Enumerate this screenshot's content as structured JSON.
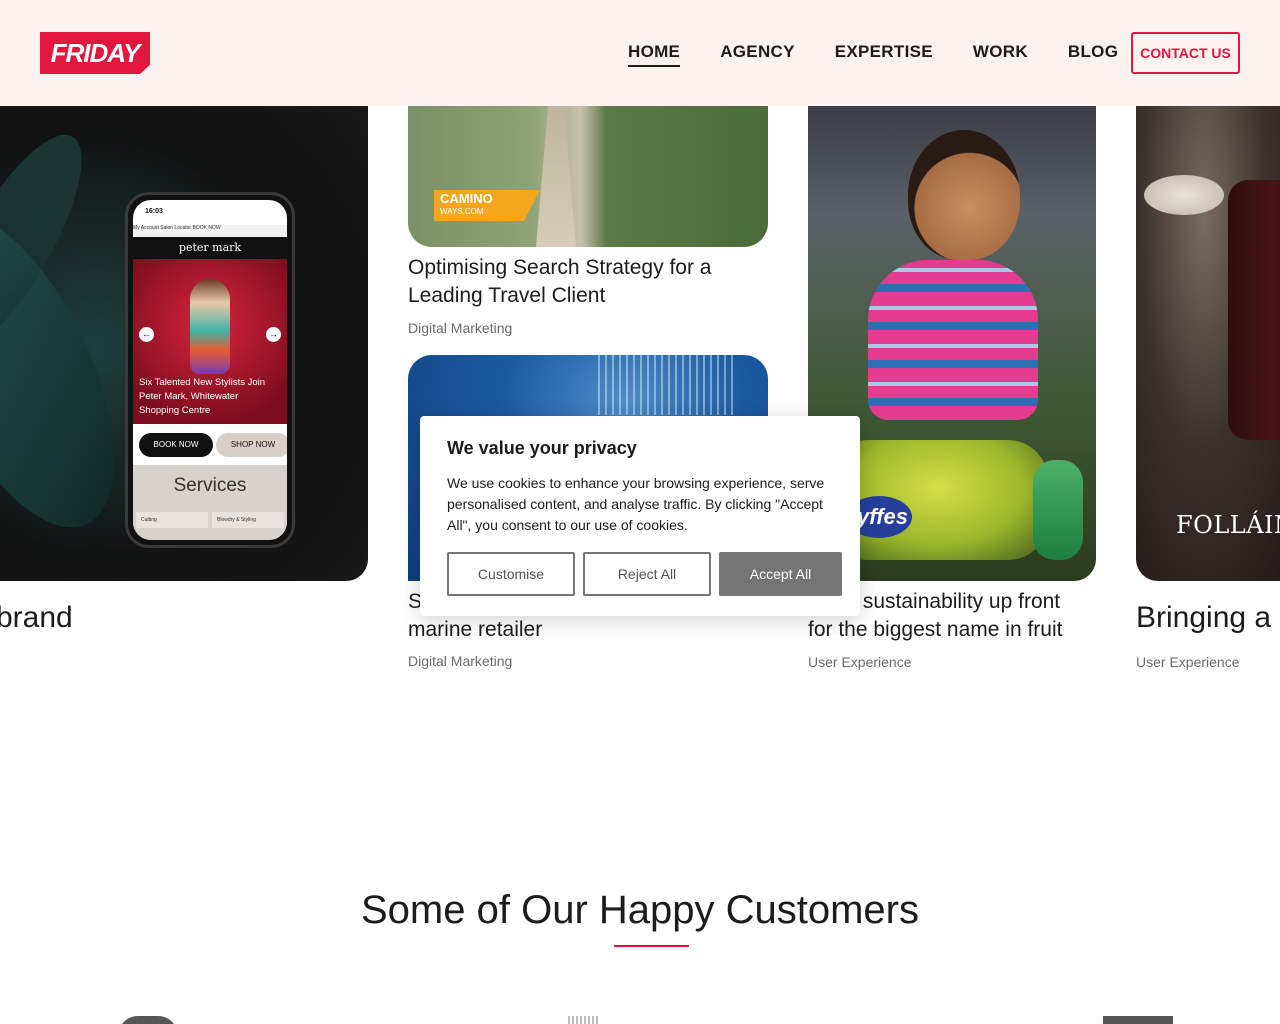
{
  "header": {
    "logo_text": "FRIDAY",
    "nav": [
      {
        "label": "HOME",
        "active": true
      },
      {
        "label": "AGENCY"
      },
      {
        "label": "EXPERTISE"
      },
      {
        "label": "WORK"
      },
      {
        "label": "BLOG"
      }
    ],
    "contact_label": "CONTACT US",
    "brand_color": "#e3173e"
  },
  "cards": {
    "peter_mark": {
      "title_partial": "brand",
      "phone": {
        "time": "16:03",
        "topbar": "My Account   Salon Locator   BOOK NOW",
        "brand": "peter mark",
        "caption": "Six Talented New Stylists Join Peter Mark, Whitewater Shopping Centre",
        "book_now": "BOOK NOW",
        "shop_now": "SHOP NOW",
        "services": "Services",
        "service_1": "Cutting",
        "service_2": "Blowdry & Styling"
      }
    },
    "camino": {
      "logo_line1": "CAMINO",
      "logo_line2": "WAYS.COM",
      "title": "Optimising Search Strategy for a Leading Travel Client",
      "category": "Digital Marketing"
    },
    "marine": {
      "title_start": "S",
      "title_end": "marine retailer",
      "category": "Digital Marketing"
    },
    "fyffes": {
      "logo": "yffes",
      "title_line1": "…ing sustainability up front",
      "title_line2": "for the biggest name in fruit",
      "category": "User Experience"
    },
    "follain": {
      "logo": "FOLLÁIN",
      "title_partial": "Bringing a",
      "category": "User Experience"
    }
  },
  "cookie": {
    "heading": "We value your privacy",
    "body": "We use cookies to enhance your browsing experience, serve personalised content, and analyse traffic. By clicking \"Accept All\", you consent to our use of cookies.",
    "customise": "Customise",
    "reject": "Reject All",
    "accept": "Accept All"
  },
  "customers": {
    "heading": "Some of Our Happy Customers"
  }
}
